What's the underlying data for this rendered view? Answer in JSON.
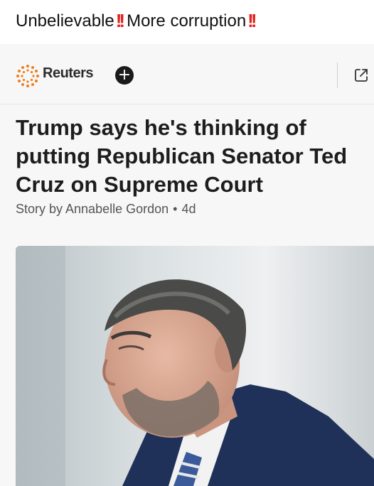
{
  "post": {
    "text": "Unbelievable",
    "text2": "More corruption",
    "emoji": "‼️"
  },
  "card": {
    "source": "Reuters",
    "follow_label": "+",
    "headline": "Trump says he's thinking of putting Republican Senator Ted Cruz on Supreme Court",
    "byline": "Story by Annabelle Gordon",
    "age": "4d"
  },
  "colors": {
    "emoji_red": "#e0211b",
    "reuters_orange": "#f07e1c"
  }
}
